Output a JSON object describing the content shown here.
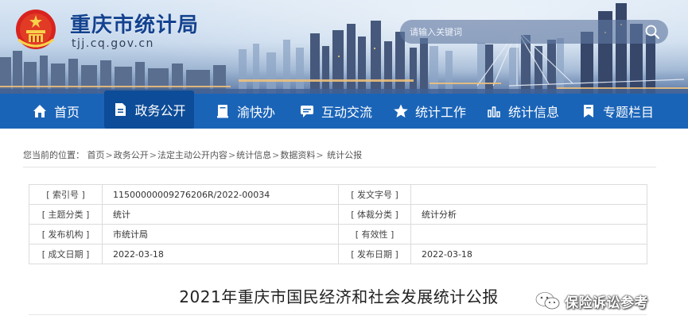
{
  "header": {
    "site_title": "重庆市统计局",
    "site_domain": "tjj.cq.gov.cn",
    "search": {
      "placeholder": "请输入关键词"
    }
  },
  "nav": {
    "items": [
      {
        "label": "首页",
        "icon": "home-icon"
      },
      {
        "label": "政务公开",
        "icon": "document-icon",
        "active": true
      },
      {
        "label": "渝快办",
        "icon": "book-icon"
      },
      {
        "label": "互动交流",
        "icon": "chat-icon"
      },
      {
        "label": "统计工作",
        "icon": "star-icon"
      },
      {
        "label": "统计信息",
        "icon": "bar-chart-icon"
      },
      {
        "label": "专题栏目",
        "icon": "bookmark-icon"
      }
    ]
  },
  "breadcrumb": {
    "label": "您当前的位置：",
    "crumbs": [
      "首页",
      "政务公开",
      "法定主动公开内容",
      "统计信息",
      "数据资料",
      "统计公报"
    ],
    "separator": ">"
  },
  "meta_table": {
    "rows": [
      {
        "k1": "[ 索引号 ]",
        "v1": "11500000009276206R/2022-00034",
        "k2": "[ 发文字号 ]",
        "v2": ""
      },
      {
        "k1": "[ 主题分类 ]",
        "v1": "统计",
        "k2": "[ 体裁分类 ]",
        "v2": "统计分析"
      },
      {
        "k1": "[ 发布机构 ]",
        "v1": "市统计局",
        "k2": "[ 有效性 ]",
        "v2": ""
      },
      {
        "k1": "[ 成文日期 ]",
        "v1": "2022-03-18",
        "k2": "[ 发布日期 ]",
        "v2": "2022-03-18"
      }
    ]
  },
  "article": {
    "title": "2021年重庆市国民经济和社会发展统计公报"
  },
  "watermark": {
    "text": "保险诉讼参考",
    "icon": "wechat-icon"
  },
  "colors": {
    "nav_bg": "#1a64b8",
    "nav_active_bg": "#0d4c98",
    "title_blue": "#13428f"
  }
}
